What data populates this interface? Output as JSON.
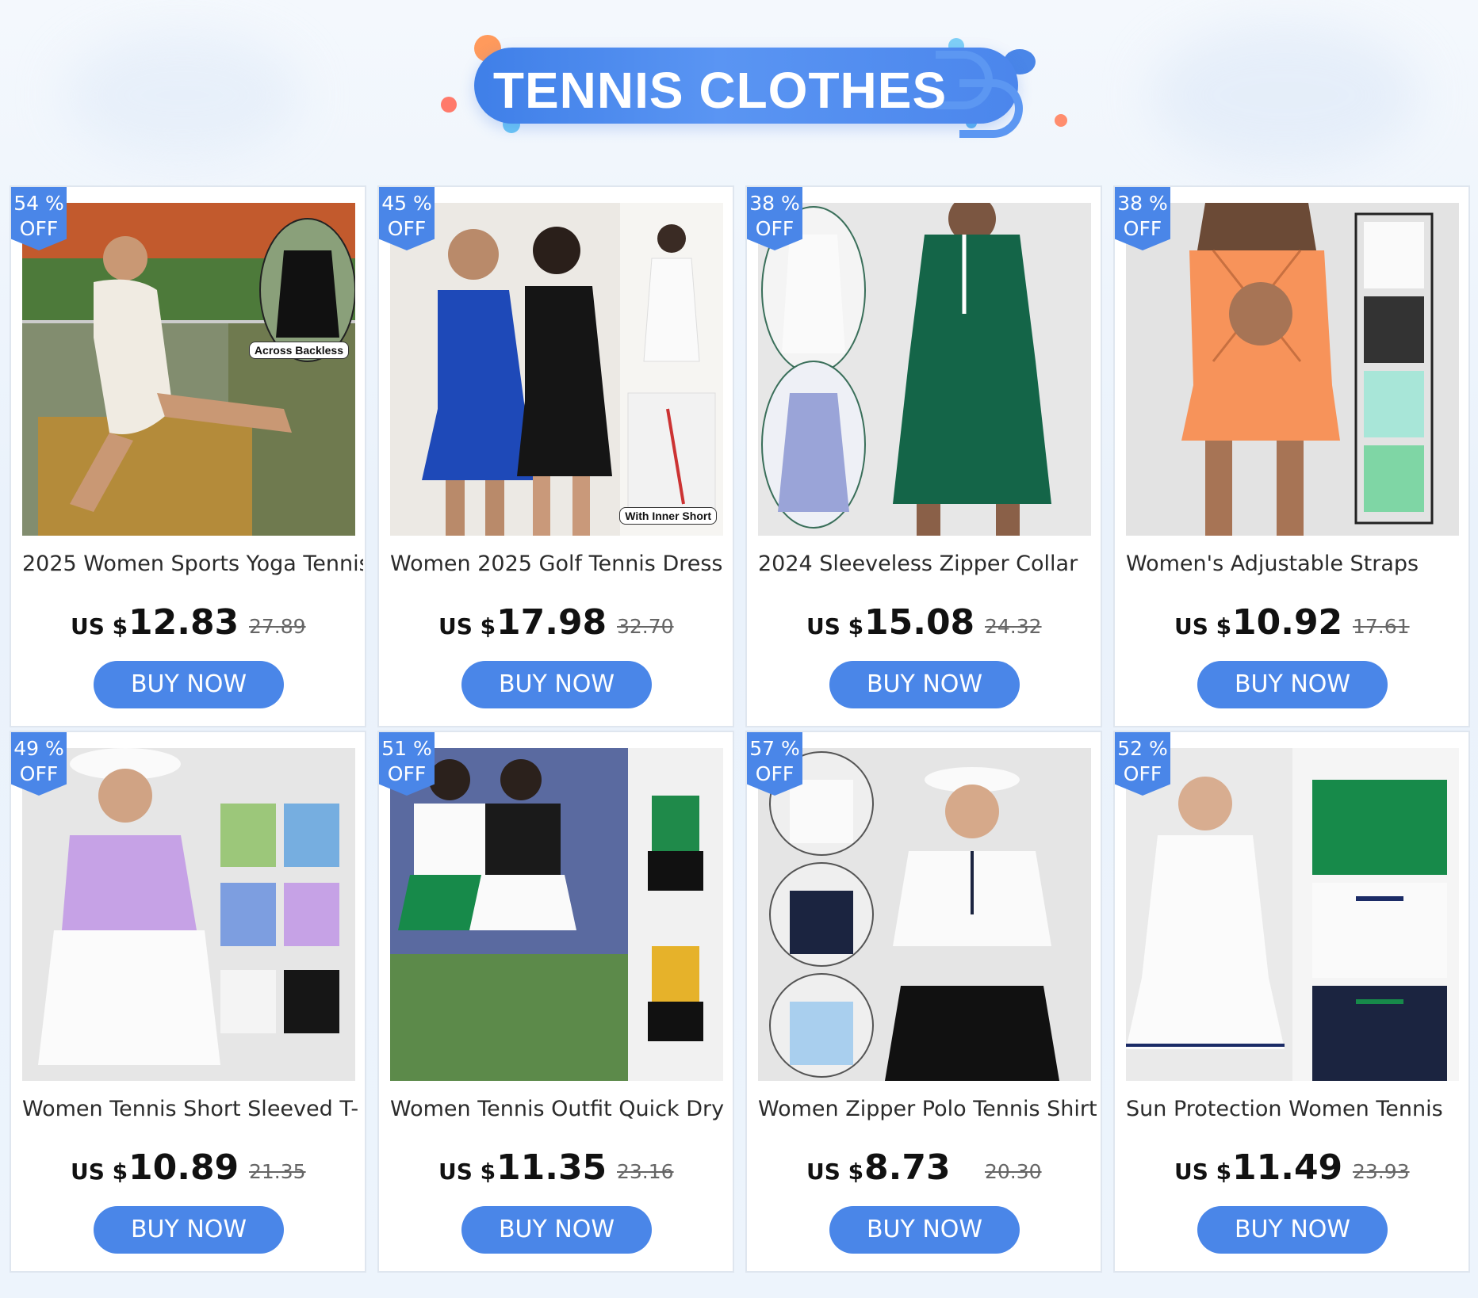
{
  "page": {
    "banner_title": "TENNIS CLOTHES",
    "accent_color": "#4a86e8"
  },
  "products": [
    {
      "discount_pct": "54 %",
      "discount_off": "OFF",
      "title": "2025 Women Sports Yoga Tennis",
      "currency": "US $",
      "price": "12.83",
      "old_price": "27.89",
      "button": "BUY NOW",
      "image_caption": "Across Backless"
    },
    {
      "discount_pct": "45 %",
      "discount_off": "OFF",
      "title": "Women 2025 Golf Tennis Dress",
      "currency": "US $",
      "price": "17.98",
      "old_price": "32.70",
      "button": "BUY NOW",
      "image_caption": "With Inner Short"
    },
    {
      "discount_pct": "38 %",
      "discount_off": "OFF",
      "title": "2024 Sleeveless Zipper Collar",
      "currency": "US $",
      "price": "15.08",
      "old_price": "24.32",
      "button": "BUY NOW"
    },
    {
      "discount_pct": "38 %",
      "discount_off": "OFF",
      "title": "Women's Adjustable Straps",
      "currency": "US $",
      "price": "10.92",
      "old_price": "17.61",
      "button": "BUY NOW"
    },
    {
      "discount_pct": "49 %",
      "discount_off": "OFF",
      "title": "Women Tennis Short Sleeved T-",
      "currency": "US $",
      "price": "10.89",
      "old_price": "21.35",
      "button": "BUY NOW"
    },
    {
      "discount_pct": "51 %",
      "discount_off": "OFF",
      "title": "Women Tennis Outfit Quick Dry",
      "currency": "US $",
      "price": "11.35",
      "old_price": "23.16",
      "button": "BUY NOW"
    },
    {
      "discount_pct": "57 %",
      "discount_off": "OFF",
      "title": "Women Zipper Polo Tennis Shirt",
      "currency": "US $",
      "price": "8.73",
      "old_price": "20.30",
      "button": "BUY NOW"
    },
    {
      "discount_pct": "52 %",
      "discount_off": "OFF",
      "title": "Sun Protection Women Tennis",
      "currency": "US $",
      "price": "11.49",
      "old_price": "23.93",
      "button": "BUY NOW"
    }
  ]
}
